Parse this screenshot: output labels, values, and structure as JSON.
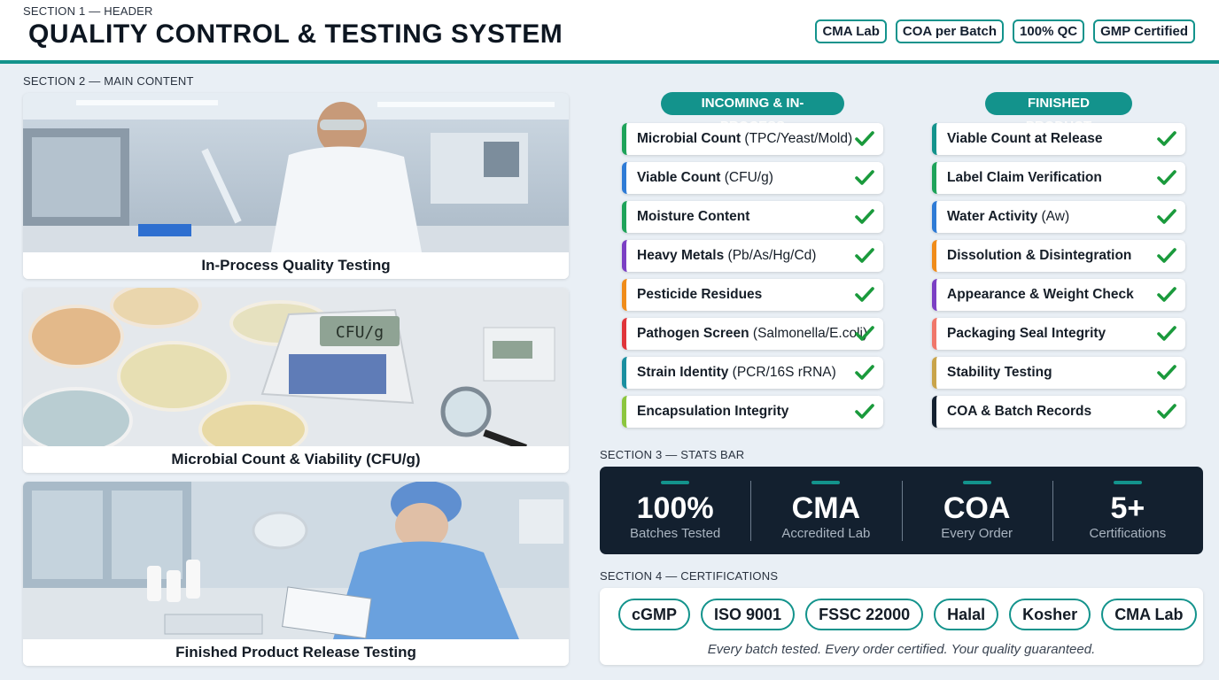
{
  "header": {
    "section_label": "SECTION 1 — HEADER",
    "title": "QUALITY CONTROL & TESTING SYSTEM",
    "badges": [
      "CMA Lab",
      "COA per Batch",
      "100% QC",
      "GMP Certified"
    ]
  },
  "main": {
    "section_label": "SECTION 2 — MAIN CONTENT",
    "photos": [
      {
        "caption": "In-Process Quality Testing"
      },
      {
        "caption": "Microbial Count & Viability (CFU/g)",
        "display_text": "CFU/g"
      },
      {
        "caption": "Finished Product Release Testing"
      }
    ],
    "incoming": {
      "header": "INCOMING & IN-PROCESS",
      "items": [
        {
          "bold": "Microbial Count",
          "sub": " (TPC/Yeast/Mold)",
          "color": "#1ea35a"
        },
        {
          "bold": "Viable Count",
          "sub": " (CFU/g)",
          "color": "#2e7bd6"
        },
        {
          "bold": "Moisture Content",
          "sub": "",
          "color": "#1ea35a"
        },
        {
          "bold": "Heavy Metals",
          "sub": " (Pb/As/Hg/Cd)",
          "color": "#7b3fc4"
        },
        {
          "bold": "Pesticide Residues",
          "sub": "",
          "color": "#f08c1a"
        },
        {
          "bold": "Pathogen Screen",
          "sub": " (Salmonella/E.coli)",
          "color": "#e0343a"
        },
        {
          "bold": "Strain Identity",
          "sub": " (PCR/16S rRNA)",
          "color": "#1a8fa0"
        },
        {
          "bold": "Encapsulation Integrity",
          "sub": "",
          "color": "#8cc63e"
        }
      ]
    },
    "finished": {
      "header": "FINISHED PRODUCT",
      "items": [
        {
          "bold": "Viable Count at Release",
          "sub": "",
          "color": "#13938c"
        },
        {
          "bold": "Label Claim Verification",
          "sub": "",
          "color": "#1ea35a"
        },
        {
          "bold": "Water Activity",
          "sub": " (Aw)",
          "color": "#2e7bd6"
        },
        {
          "bold": "Dissolution & Disintegration",
          "sub": "",
          "color": "#f08c1a"
        },
        {
          "bold": "Appearance & Weight Check",
          "sub": "",
          "color": "#7b3fc4"
        },
        {
          "bold": "Packaging Seal Integrity",
          "sub": "",
          "color": "#f0776a"
        },
        {
          "bold": "Stability Testing",
          "sub": "",
          "color": "#c9a44a"
        },
        {
          "bold": "COA & Batch Records",
          "sub": "",
          "color": "#13202f"
        }
      ]
    },
    "check_color": "#1a9a3c"
  },
  "stats": {
    "section_label": "SECTION 3 — STATS BAR",
    "items": [
      {
        "value": "100%",
        "caption": "Batches Tested"
      },
      {
        "value": "CMA",
        "caption": "Accredited Lab"
      },
      {
        "value": "COA",
        "caption": "Every Order"
      },
      {
        "value": "5+",
        "caption": "Certifications"
      }
    ]
  },
  "certifications": {
    "section_label": "SECTION 4 — CERTIFICATIONS",
    "items": [
      "cGMP",
      "ISO 9001",
      "FSSC 22000",
      "Halal",
      "Kosher",
      "CMA Lab"
    ],
    "tagline": "Every batch tested. Every order certified. Your quality guaranteed."
  },
  "colors": {
    "accent": "#13938c",
    "dark": "#13202f"
  }
}
